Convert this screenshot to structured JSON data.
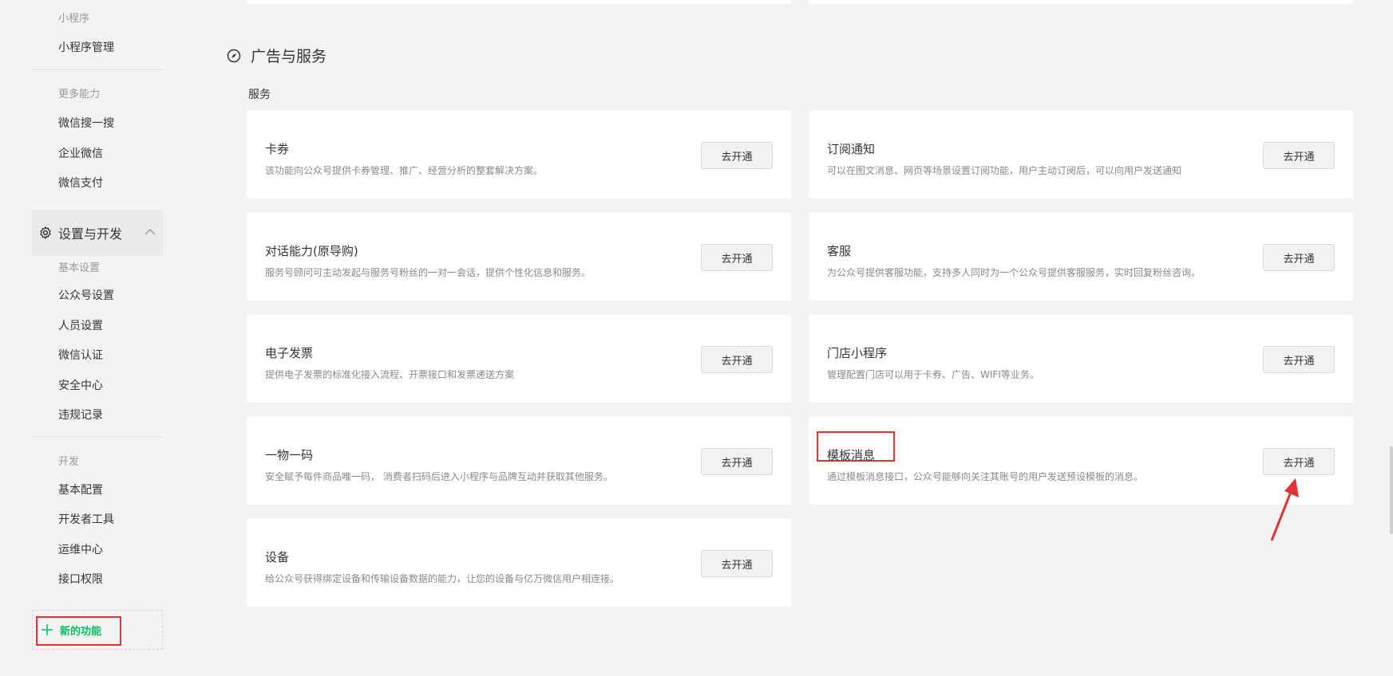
{
  "sidebar": {
    "group_miniprogram": "小程序",
    "item_miniprogram_manage": "小程序管理",
    "group_more": "更多能力",
    "item_wechat_search": "微信搜一搜",
    "item_wecom": "企业微信",
    "item_wechat_pay": "微信支付",
    "section_settings_dev": "设置与开发",
    "group_basic_settings": "基本设置",
    "item_account_settings": "公众号设置",
    "item_staff_settings": "人员设置",
    "item_wechat_verify": "微信认证",
    "item_security_center": "安全中心",
    "item_violation_records": "违规记录",
    "group_dev": "开发",
    "item_basic_config": "基本配置",
    "item_dev_tools": "开发者工具",
    "item_ops_center": "运维中心",
    "item_api_permissions": "接口权限",
    "new_function": "新的功能"
  },
  "main": {
    "section_title": "广告与服务",
    "sub_title": "服务",
    "button_label": "去开通",
    "cards": [
      {
        "title": "卡券",
        "desc": "该功能向公众号提供卡券管理、推广、经营分析的整套解决方案。"
      },
      {
        "title": "订阅通知",
        "desc": "可以在图文消息、网页等场景设置订阅功能，用户主动订阅后，可以向用户发送通知"
      },
      {
        "title": "对话能力(原导购)",
        "desc": "服务号顾问可主动发起与服务号粉丝的一对一会话，提供个性化信息和服务。"
      },
      {
        "title": "客服",
        "desc": "为公众号提供客服功能，支持多人同时为一个公众号提供客服服务，实时回复粉丝咨询。"
      },
      {
        "title": "电子发票",
        "desc": "提供电子发票的标准化接入流程、开票接口和发票递送方案"
      },
      {
        "title": "门店小程序",
        "desc": "管理配置门店可以用于卡券、广告、WIFI等业务。"
      },
      {
        "title": "一物一码",
        "desc": "安全赋予每件商品唯一码， 消费者扫码后进入小程序与品牌互动并获取其他服务。"
      },
      {
        "title": "模板消息",
        "desc": "通过模板消息接口，公众号能够向关注其账号的用户发送预设模板的消息。"
      },
      {
        "title": "设备",
        "desc": "给公众号获得绑定设备和传输设备数据的能力，让您的设备与亿万微信用户相连接。"
      }
    ]
  },
  "colors": {
    "accent_green": "#07c160",
    "highlight_red": "#e33333"
  }
}
